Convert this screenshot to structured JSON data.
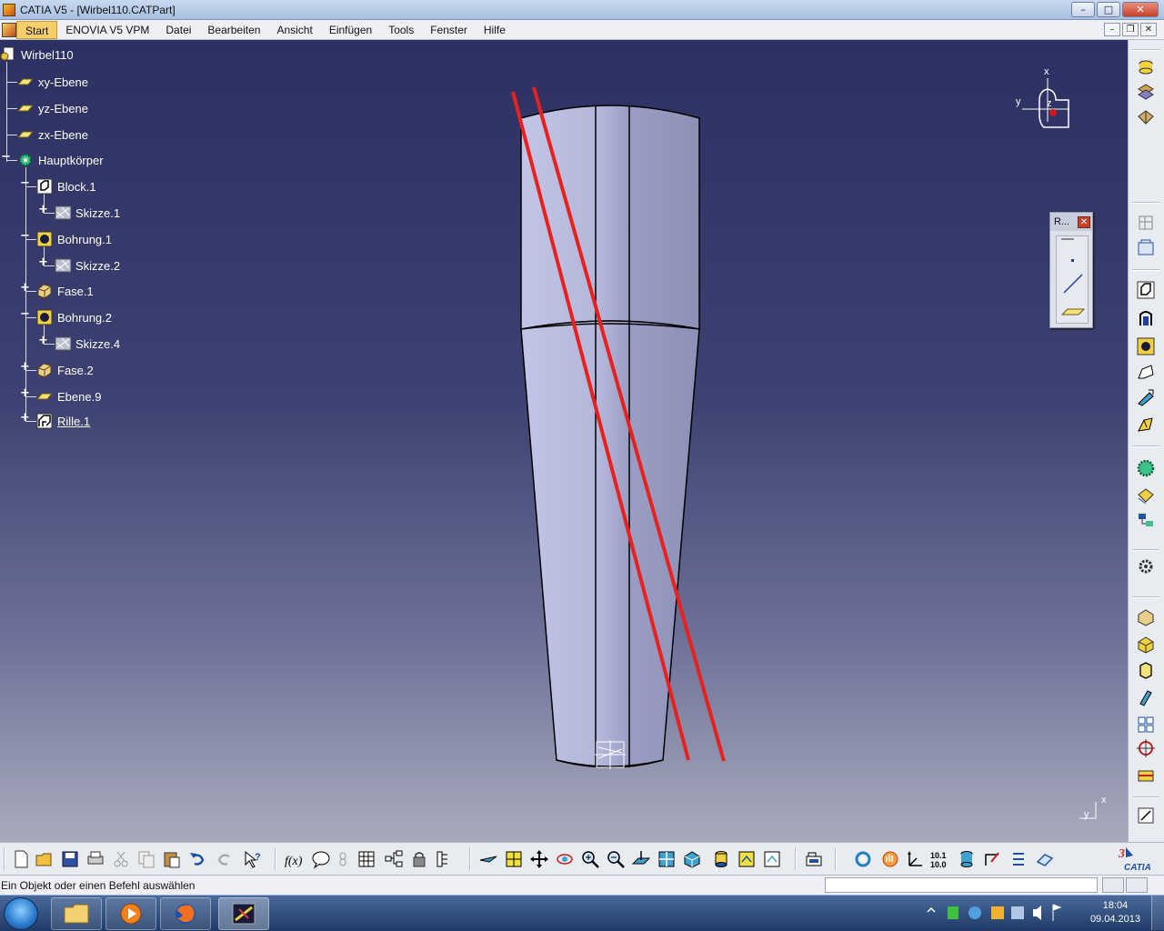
{
  "window": {
    "title": "CATIA V5 - [Wirbel110.CATPart]",
    "minimize": "–",
    "maximize": "□",
    "close": "✕"
  },
  "menu": {
    "items": [
      {
        "label": "Start",
        "active": true
      },
      {
        "label": "ENOVIA V5 VPM"
      },
      {
        "label": "Datei"
      },
      {
        "label": "Bearbeiten"
      },
      {
        "label": "Ansicht"
      },
      {
        "label": "Einfügen"
      },
      {
        "label": "Tools"
      },
      {
        "label": "Fenster"
      },
      {
        "label": "Hilfe"
      }
    ],
    "doc_minimize": "–",
    "doc_restore": "❐",
    "doc_close": "✕"
  },
  "tree": {
    "root": "Wirbel110",
    "nodes": [
      {
        "label": "xy-Ebene",
        "icon": "plane-icon"
      },
      {
        "label": "yz-Ebene",
        "icon": "plane-icon"
      },
      {
        "label": "zx-Ebene",
        "icon": "plane-icon"
      },
      {
        "label": "Hauptkörper",
        "icon": "gear-body-icon"
      },
      {
        "label": "Block.1",
        "icon": "pad-icon"
      },
      {
        "label": "Skizze.1",
        "icon": "sketch-icon"
      },
      {
        "label": "Bohrung.1",
        "icon": "hole-icon"
      },
      {
        "label": "Skizze.2",
        "icon": "sketch-icon"
      },
      {
        "label": "Fase.1",
        "icon": "chamfer-icon"
      },
      {
        "label": "Bohrung.2",
        "icon": "hole-icon"
      },
      {
        "label": "Skizze.4",
        "icon": "sketch-icon"
      },
      {
        "label": "Fase.2",
        "icon": "chamfer-icon"
      },
      {
        "label": "Ebene.9",
        "icon": "plane-icon"
      },
      {
        "label": "Rille.1",
        "icon": "groove-icon"
      }
    ]
  },
  "compass": {
    "x_label": "x",
    "y_label": "y",
    "z_label": "z"
  },
  "axis_indicator": {
    "x_label": "x",
    "y_label": "y"
  },
  "palette": {
    "title": "R...",
    "close": "✕"
  },
  "status": {
    "message": "Ein Objekt oder einen Befehl auswählen",
    "command_input": ""
  },
  "taskbar": {
    "time": "18:04",
    "date": "09.04.2013"
  },
  "colors": {
    "viewport_top": "#2c3062",
    "part_surface": "#b6b9dc",
    "red_line": "#e8211f"
  }
}
